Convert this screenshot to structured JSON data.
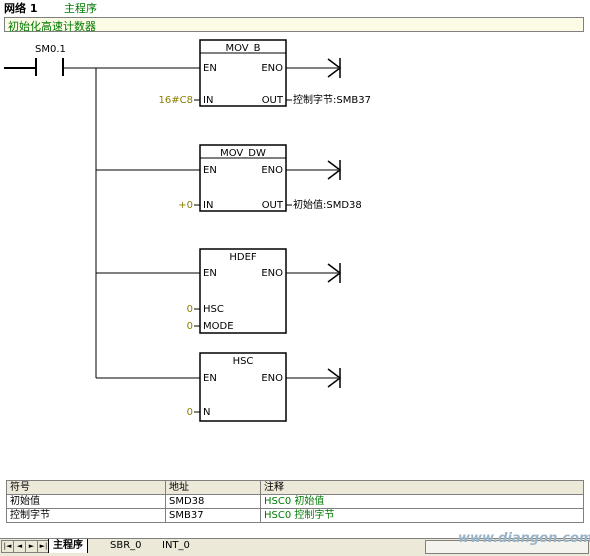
{
  "header": {
    "network": "网络 1",
    "title": "主程序"
  },
  "network_comment": "初始化高速计数器",
  "contact": {
    "label": "SM0.1"
  },
  "boxes": [
    {
      "name": "MOV_B",
      "en": "EN",
      "eno": "ENO",
      "inputs": [
        {
          "pin": "IN",
          "operand": "16#C8"
        }
      ],
      "output": {
        "pin": "OUT",
        "operand": "控制字节:SMB37"
      }
    },
    {
      "name": "MOV_DW",
      "en": "EN",
      "eno": "ENO",
      "inputs": [
        {
          "pin": "IN",
          "operand": "+0"
        }
      ],
      "output": {
        "pin": "OUT",
        "operand": "初始值:SMD38"
      }
    },
    {
      "name": "HDEF",
      "en": "EN",
      "eno": "ENO",
      "inputs": [
        {
          "pin": "HSC",
          "operand": "0"
        },
        {
          "pin": "MODE",
          "operand": "0"
        }
      ]
    },
    {
      "name": "HSC",
      "en": "EN",
      "eno": "ENO",
      "inputs": [
        {
          "pin": "N",
          "operand": "0"
        }
      ]
    }
  ],
  "symbol_table": {
    "headers": [
      "符号",
      "地址",
      "注释"
    ],
    "rows": [
      [
        "初始值",
        "SMD38",
        "HSC0 初始值"
      ],
      [
        "控制字节",
        "SMB37",
        "HSC0 控制字节"
      ]
    ]
  },
  "tabs": {
    "nav": [
      "|◄",
      "◄",
      "►",
      "►|"
    ],
    "main": "主程序",
    "sbr": "SBR_0",
    "int": "INT_0"
  },
  "watermark": "www.diangon.com",
  "colors": {
    "comment_text": "#007a00",
    "operand": "#8b7d00",
    "box_border": "#000000"
  }
}
